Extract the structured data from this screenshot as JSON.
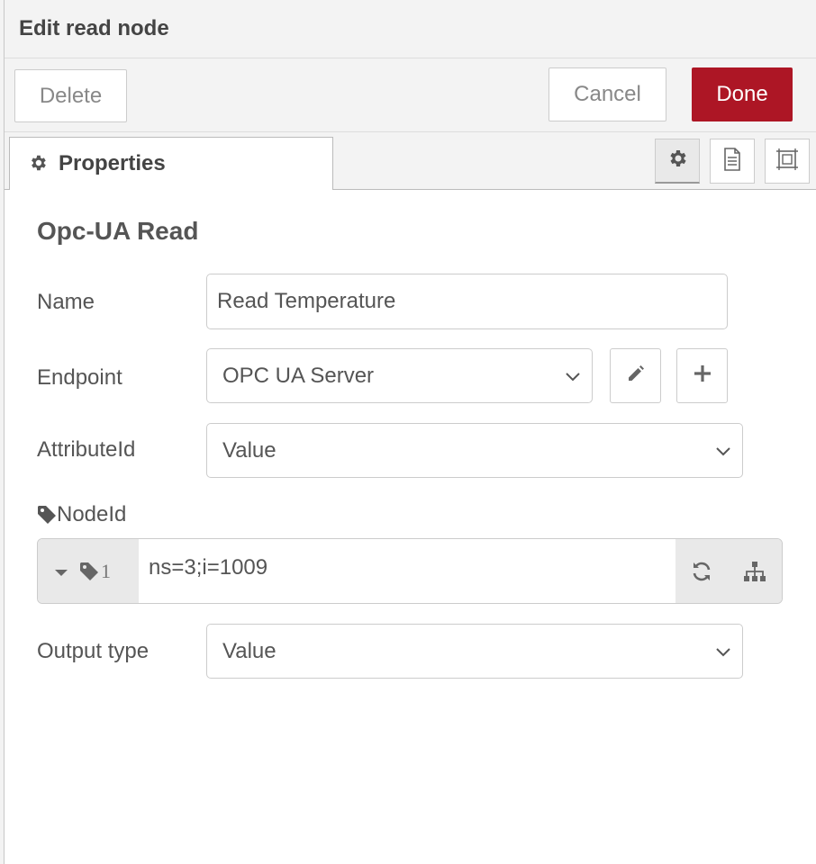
{
  "header": {
    "title": "Edit read node"
  },
  "toolbar": {
    "delete_label": "Delete",
    "cancel_label": "Cancel",
    "done_label": "Done",
    "done_color": "#ad1625"
  },
  "tabs": {
    "properties_label": "Properties",
    "properties_icon": "gear-icon",
    "side_buttons": [
      "gear-icon",
      "document-icon",
      "frame-icon"
    ]
  },
  "form": {
    "section_title": "Opc-UA Read",
    "name": {
      "label": "Name",
      "value": "Read Temperature"
    },
    "endpoint": {
      "label": "Endpoint",
      "value": "OPC UA Server",
      "edit_icon": "pencil-icon",
      "add_icon": "plus-icon"
    },
    "attribute_id": {
      "label": "AttributeId",
      "value": "Value"
    },
    "node_id": {
      "label": "NodeId",
      "label_icon": "tag-icon",
      "type_indicator": "1",
      "value": "ns=3;i=1009",
      "refresh_icon": "refresh-icon",
      "browse_icon": "sitemap-icon"
    },
    "output_type": {
      "label": "Output type",
      "value": "Value"
    }
  }
}
